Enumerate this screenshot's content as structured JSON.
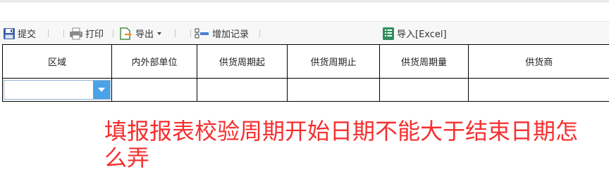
{
  "toolbar": {
    "submit_label": "提交",
    "print_label": "打印",
    "export_label": "导出",
    "add_record_label": "增加记录",
    "import_excel_label": "导入[Excel]"
  },
  "table": {
    "columns": [
      "区域",
      "内外部单位",
      "供货周期起",
      "供货周期止",
      "供货周期量",
      "供货商"
    ],
    "rows": [
      [
        "",
        "",
        "",
        "",
        "",
        ""
      ]
    ]
  },
  "question_text": "填报报表校验周期开始日期不能大于结束日期怎么弄",
  "colors": {
    "question": "#f52f2f",
    "combo_button": "#4aa3e6",
    "toolbar_bg": "#f7f7f7"
  },
  "icons": [
    "save-icon",
    "print-icon",
    "export-icon",
    "add-record-icon",
    "excel-icon",
    "chevron-down-icon"
  ]
}
